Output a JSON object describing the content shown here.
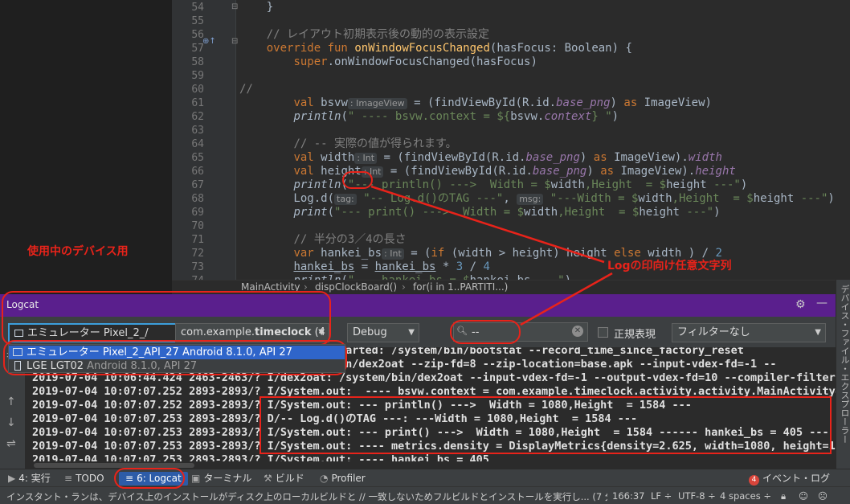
{
  "editor": {
    "lines": [
      {
        "n": "54",
        "html": "    }"
      },
      {
        "n": "55",
        "html": ""
      },
      {
        "n": "56",
        "html": "    <span class=\"cmt2\">// レイアウト初期表示後の動的の表示設定</span>"
      },
      {
        "n": "57",
        "html": "    <span class=\"kw\">override fun</span> <span class=\"fn\">onWindowFocusChanged</span>(hasFocus: Boolean) {"
      },
      {
        "n": "58",
        "html": "        <span class=\"kw\">super</span>.onWindowFocusChanged(hasFocus)"
      },
      {
        "n": "59",
        "html": ""
      },
      {
        "n": "60",
        "html": "<span class=\"cmt2\">//</span>"
      },
      {
        "n": "61",
        "html": "        <span class=\"kw\">val</span> bsvw<span class=\"hint\">: ImageView</span> = (findViewById(R.id.<span class=\"prop\">base_png</span>) <span class=\"kw\">as</span> ImageView)"
      },
      {
        "n": "62",
        "html": "        <span class=\"println\">println</span>(<span class=\"str\">\" ---- bsvw.context = ${</span>bsvw.<span class=\"prop\">context</span><span class=\"str\">} \"</span>)"
      },
      {
        "n": "63",
        "html": ""
      },
      {
        "n": "64",
        "html": "        <span class=\"cmt2\">// -- 実際の値が得られます。</span>"
      },
      {
        "n": "65",
        "html": "        <span class=\"kw\">val</span> width<span class=\"hint\">: Int</span> = (findViewById(R.id.<span class=\"prop\">base_png</span>) <span class=\"kw\">as</span> ImageView).<span class=\"prop\">width</span>"
      },
      {
        "n": "66",
        "html": "        <span class=\"kw\">val</span> height<span class=\"hint\">: Int</span> = (findViewById(R.id.<span class=\"prop\">base_png</span>) <span class=\"kw\">as</span> ImageView).<span class=\"prop\">height</span>"
      },
      {
        "n": "67",
        "html": "        <span class=\"println\">println</span>(<span class=\"str\">\"--- println() --->  Width = $</span>width<span class=\"str\">,Height  = $</span>height<span class=\"str\"> ---\"</span>)"
      },
      {
        "n": "68",
        "html": "        Log.d(<span class=\"hint\">tag:</span> <span class=\"str\">\"-- Log.d()のTAG ---\"</span>, <span class=\"hint\">msg:</span> <span class=\"str\">\"---Width = $</span>width<span class=\"str\">,Height  = $</span>height<span class=\"str\"> ---\"</span>)"
      },
      {
        "n": "69",
        "html": "        <span class=\"println\">print</span>(<span class=\"str\">\"--- print() --->  Width = $</span>width<span class=\"str\">,Height  = $</span>height<span class=\"str\"> ---\"</span>)"
      },
      {
        "n": "70",
        "html": ""
      },
      {
        "n": "71",
        "html": "        <span class=\"cmt2\">// 半分の3／4の長さ</span>"
      },
      {
        "n": "72",
        "html": "        <span class=\"kw\">var</span> hankei_bs<span class=\"hint\">: Int</span> = (<span class=\"kw\">if</span> (width > height) height <span class=\"kw\">else</span> width ) / <span style=\"color:#6897bb\">2</span>"
      },
      {
        "n": "73",
        "html": "        <span class=\"ul\">hankei_bs</span> = <span class=\"ul\">hankei_bs</span> * <span style=\"color:#6897bb\">3</span> / <span style=\"color:#6897bb\">4</span>"
      },
      {
        "n": "74",
        "html": "        <span class=\"println\">println</span>(<span class=\"str\">\"--- hankei_bs = $</span>hankei_bs<span class=\"str\"> ---\"</span>)"
      }
    ]
  },
  "breadcrumb": [
    "MainActivity",
    "dispClockBoard()",
    "for(i in 1..PARTITI...)"
  ],
  "right_strip_label": "デバイス・ファイル・エクスプローラー",
  "logcat": {
    "title": "Logcat",
    "device_selected": "エミュレーター Pixel_2_/",
    "package_prefix": "com.example.",
    "package_bold": "timeclock",
    "package_suffix": " (4",
    "level": "Debug",
    "search_value": "--",
    "regex_label": "正規表現",
    "filter": "フィルターなし",
    "device_options": [
      {
        "main": "エミュレーター Pixel_2_API_27 Android 8.1.0, API 27",
        "sub": ""
      },
      {
        "main": "LGE LGT02",
        "sub": " Android 8.1.0, API 27"
      }
    ],
    "lines": [
      "                                    : Service started: /system/bin/bootstat --record_time_since_factory_reset",
      "                                    : /system/bin/dex2oat --zip-fd=8 --zip-location=base.apk --input-vdex-fd=-1 --",
      "2019-07-04 10:06:44.424 2463-2463/? I/dex2oat: /system/bin/dex2oat --input-vdex-fd=-1 --output-vdex-fd=10 --compiler-filter",
      "2019-07-04 10:07:07.252 2893-2893/? I/System.out:  ---- bsvw.context = com.example.timeclock.activity.activity.MainActivity@",
      "2019-07-04 10:07:07.252 2893-2893/? I/System.out: --- println() --->  Width = 1080,Height  = 1584 ---",
      "2019-07-04 10:07:07.253 2893-2893/? D/-- Log.d()のTAG ---: ---Width = 1080,Height  = 1584 ---",
      "2019-07-04 10:07:07.253 2893-2893/? I/System.out: --- print() --->  Width = 1080,Height  = 1584 ------ hankei_bs = 405 ---",
      "2019-07-04 10:07:07.253 2893-2893/? I/System.out: ---- metrics.density = DisplayMetrics{density=2.625, width=1080, height=17",
      "2019-07-04 10:07:07.253 2893-2893/? I/System.out: ---- hankei_bs = 405"
    ]
  },
  "tool_windows": {
    "run": "4: 実行",
    "todo": "TODO",
    "logcat": "6: Logcat",
    "terminal": "ターミナル",
    "build": "ビルド",
    "profiler": "Profiler",
    "event_count": "4",
    "event_log": "イベント・ログ"
  },
  "status": {
    "message": "インスタント・ランは、デバイス上のインストールがディスク上のローカルビルドと // 一致しないためフルビルドとインストールを実行し... (7 分前)",
    "position": "166:37",
    "line_sep": "LF ÷",
    "encoding": "UTF-8 ÷",
    "indent": "4 spaces ÷"
  },
  "annotations": {
    "device_label": "使用中のデバイス用",
    "log_label": "Logの印向け任意文字列"
  },
  "colors": {
    "accent_red": "#e8231a",
    "logcat_header": "#5a1f8d",
    "selection_blue": "#2f65ca"
  }
}
